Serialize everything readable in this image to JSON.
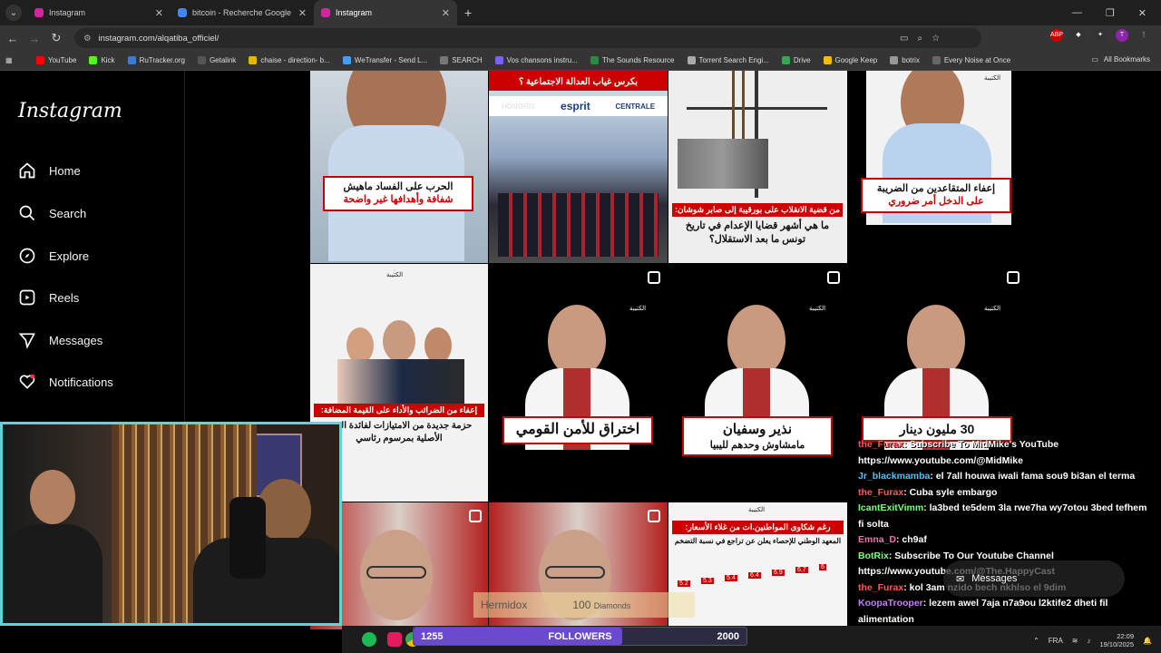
{
  "tabs": [
    {
      "title": "Instagram",
      "active": false,
      "favcolor": "#d6249f"
    },
    {
      "title": "bitcoin - Recherche Google",
      "active": false,
      "favcolor": "#4285f4"
    },
    {
      "title": "Instagram",
      "active": true,
      "favcolor": "#d6249f"
    }
  ],
  "address": {
    "url": "instagram.com/alqatiba_officiel/"
  },
  "bookmarks": [
    {
      "label": "YouTube",
      "color": "#ff0000"
    },
    {
      "label": "Kick",
      "color": "#53fc18"
    },
    {
      "label": "RuTracker.org",
      "color": "#3a7bd5"
    },
    {
      "label": "Getalink",
      "color": "#555"
    },
    {
      "label": "chaise - direction- b...",
      "color": "#e8b400"
    },
    {
      "label": "WeTransfer - Send L...",
      "color": "#409fff"
    },
    {
      "label": "SEARCH",
      "color": "#777"
    },
    {
      "label": "Vos chansons instru...",
      "color": "#7b61ff"
    },
    {
      "label": "The Sounds Resource",
      "color": "#2b8a3e"
    },
    {
      "label": "Torrent Search Engi...",
      "color": "#aaa"
    },
    {
      "label": "Drive",
      "color": "#34a853"
    },
    {
      "label": "Google Keep",
      "color": "#fbbc04"
    },
    {
      "label": "botrix",
      "color": "#999"
    },
    {
      "label": "Every Noise at Once",
      "color": "#666"
    }
  ],
  "all_bookmarks": "All Bookmarks",
  "sidebar": {
    "logo": "Instagram",
    "items": [
      {
        "label": "Home"
      },
      {
        "label": "Search"
      },
      {
        "label": "Explore"
      },
      {
        "label": "Reels"
      },
      {
        "label": "Messages"
      },
      {
        "label": "Notifications"
      }
    ]
  },
  "posts": {
    "p1": "الحرب على الفساد ماهيش",
    "p1b": "شفافة وأهدافها غير واضحة",
    "p2top": "بكرس غياب العدالة الاجتماعية ؟",
    "p3a": "من قضية الانقلاب على بورقيبة إلى صابر شوشان:",
    "p3b": "ما هي أشهر قضايا الإعدام في تاريخ تونس ما بعد الاستقلال؟",
    "p4a": "إعفاء المتقاعدين من الضريبة",
    "p4b": "على الدخل أمر ضروري",
    "p5a": "إعفاء من الضرائب والأداء على القيمة المضافة:",
    "p5b": "حزمة جديدة من الامتيازات لفائدة التو... الأصلية بمرسوم رئاسي",
    "p6": "اختراق للأمن القومي",
    "p7a": "نذير وسفيان",
    "p7b": "مامشاوش وحدهم لليبيا",
    "p8": "30 مليون دينار",
    "p11a": "رغم شكاوى المواطنين.ات من غلاء الأسعار:",
    "p11b": "المعهد الوطني للإحصاء يعلن عن تراجع في نسبة التضخم",
    "owl": "الكتيبة",
    "esprit": "esprit",
    "honoris": "HONORIS",
    "centrale": "CENTRALE"
  },
  "chat": [
    {
      "user": "the_Furax",
      "msg": ": Subscribe To MidMike's YouTube https://www.youtube.com/@MidMike"
    },
    {
      "user": "Jr_blackmamba",
      "msg": ": el 7all houwa iwali fama sou9 bi3an el terma"
    },
    {
      "user": "the_Furax",
      "msg": ": Cuba syle embargo"
    },
    {
      "user": "IcantExitVimm",
      "msg": ": la3bed te5dem 3la rwe7ha wy7otou 3bed tefhem fi solta"
    },
    {
      "user": "Emna_D",
      "msg": ": ch9af"
    },
    {
      "user": "BotRix",
      "msg": ": Subscribe To Our Youtube Channel https://www.youtube.com/@The.HappyCast"
    },
    {
      "user": "the_Furax",
      "msg": ": kol 3am nzido bech nkhlso el 9dim"
    },
    {
      "user": "KoopaTrooper",
      "msg": ": lezem awel 7aja n7a9ou l2ktife2 dheti fil alimentation"
    }
  ],
  "followers": {
    "current": "1255",
    "label": "FOLLOWERS",
    "goal": "2000",
    "progress": 0.6275
  },
  "alert": {
    "name": "Hermidox",
    "amount": "100",
    "unit": "Diamonds"
  },
  "messages_label": "Messages",
  "clock": {
    "time": "22:09",
    "date": "19/10/2025"
  },
  "lang": "FRA",
  "chart": {
    "values": [
      "5.2",
      "5.3",
      "5.4",
      "6.4",
      "6.9",
      "6.7",
      "6"
    ]
  }
}
